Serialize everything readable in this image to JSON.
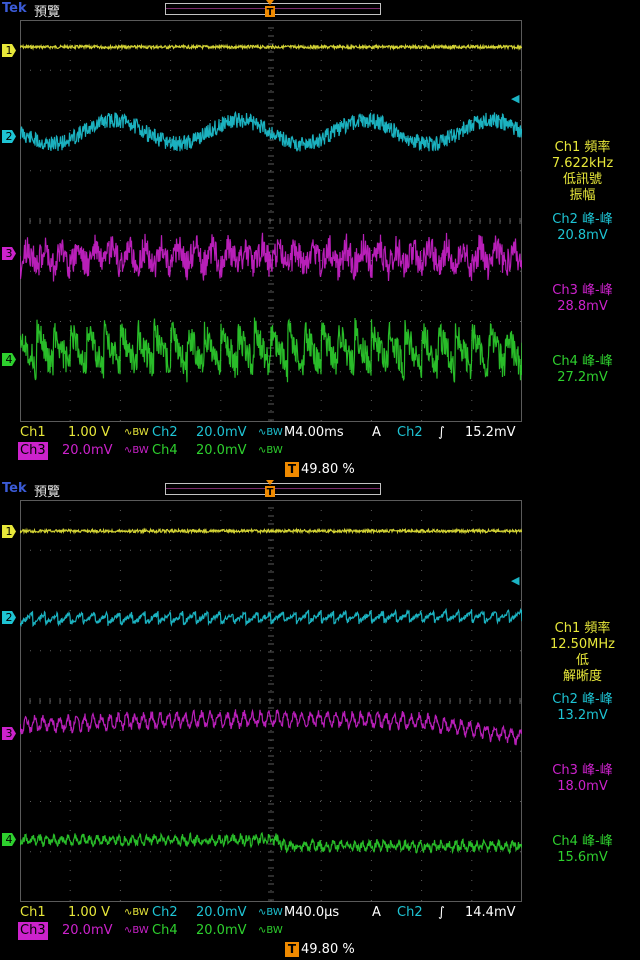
{
  "colors": {
    "ch1": "#e8e83a",
    "ch2": "#1ec4d4",
    "ch3": "#cc22cc",
    "ch4": "#2ed02e",
    "grid": "#5a5a5a",
    "trigger": "#f08a00"
  },
  "screens": [
    {
      "brand": "Tek",
      "mode": "預覽",
      "markers": [
        "1",
        "2",
        "3",
        "4"
      ],
      "ch1_meas": {
        "label": "Ch1 頻率",
        "value": "7.622kHz",
        "note1": "低訊號",
        "note2": "振幅"
      },
      "ch2_meas": {
        "label": "Ch2 峰-峰",
        "value": "20.8mV"
      },
      "ch3_meas": {
        "label": "Ch3 峰-峰",
        "value": "28.8mV"
      },
      "ch4_meas": {
        "label": "Ch4 峰-峰",
        "value": "27.2mV"
      },
      "status": {
        "ch1": "Ch1",
        "ch1_scale": "1.00 V",
        "ch2": "Ch2",
        "ch2_scale": "20.0mV",
        "ch3": "Ch3",
        "ch3_scale": "20.0mV",
        "ch4": "Ch4",
        "ch4_scale": "20.0mV",
        "bw": "BW",
        "timebase": "M4.00ms",
        "acq": "A",
        "trig_src": "Ch2",
        "trig_slope": "∫",
        "trig_level": "15.2mV",
        "trig_pos": "49.80 %"
      },
      "wave": {
        "ch2_cycles": 4,
        "ch3_cycles": 30,
        "ch4_cycles": 30
      }
    },
    {
      "brand": "Tek",
      "mode": "預覽",
      "markers": [
        "1",
        "2",
        "3",
        "4"
      ],
      "ch1_meas": {
        "label": "Ch1 頻率",
        "value": "12.50MHz",
        "note1": "低",
        "note2": "解晰度"
      },
      "ch2_meas": {
        "label": "Ch2 峰-峰",
        "value": "13.2mV"
      },
      "ch3_meas": {
        "label": "Ch3 峰-峰",
        "value": "18.0mV"
      },
      "ch4_meas": {
        "label": "Ch4 峰-峰",
        "value": "15.6mV"
      },
      "status": {
        "ch1": "Ch1",
        "ch1_scale": "1.00 V",
        "ch2": "Ch2",
        "ch2_scale": "20.0mV",
        "ch3": "Ch3",
        "ch3_scale": "20.0mV",
        "ch4": "Ch4",
        "ch4_scale": "20.0mV",
        "bw": "BW",
        "timebase": "M40.0µs",
        "acq": "A",
        "trig_src": "Ch2",
        "trig_slope": "∫",
        "trig_level": "14.4mV",
        "trig_pos": "49.80 %"
      },
      "wave": {
        "ch2_cycles": 40,
        "ch3_cycles": 60,
        "ch4_cycles": 70
      }
    }
  ]
}
